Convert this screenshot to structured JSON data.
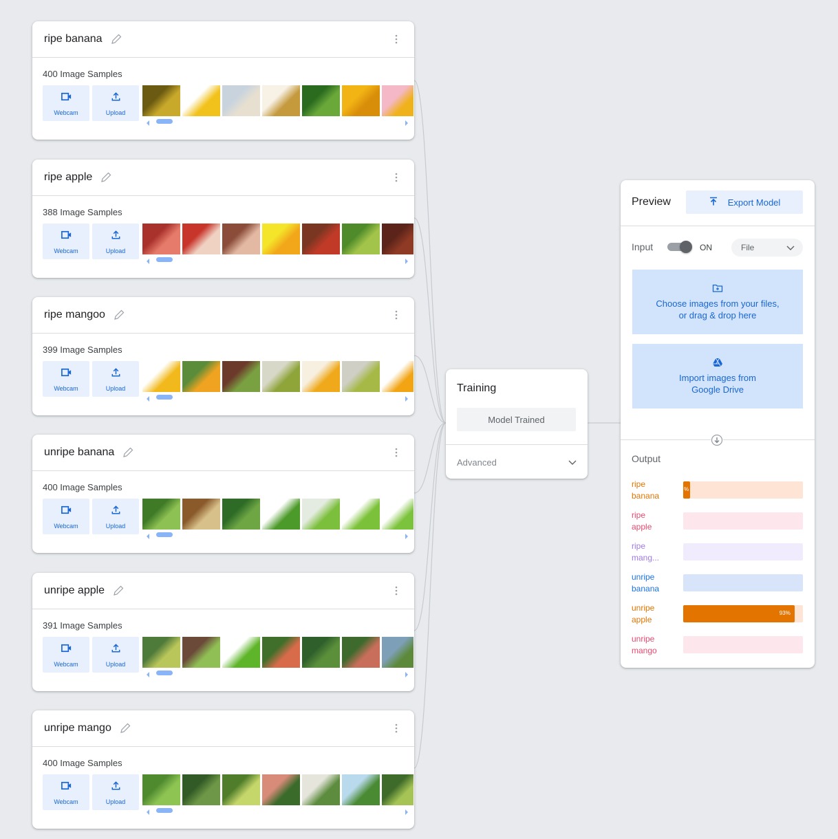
{
  "classes": [
    {
      "name": "ripe banana",
      "count_text": "400 Image Samples",
      "thumb_colors": [
        [
          "#6b5a12",
          "#c9a92a"
        ],
        [
          "#ffffff",
          "#f2c21c"
        ],
        [
          "#c9d3de",
          "#e7dfd0"
        ],
        [
          "#f7f1e6",
          "#c59a3c"
        ],
        [
          "#2a6b1f",
          "#6ba83a"
        ],
        [
          "#f2b414",
          "#d98e0a"
        ],
        [
          "#f4b8c6",
          "#f0b21a"
        ]
      ]
    },
    {
      "name": "ripe apple",
      "count_text": "388 Image Samples",
      "thumb_colors": [
        [
          "#a9322c",
          "#e77b6b"
        ],
        [
          "#c8352b",
          "#f0d2c3"
        ],
        [
          "#8b4d3a",
          "#e3b9a3"
        ],
        [
          "#f4e52a",
          "#f2a71a"
        ],
        [
          "#7b3622",
          "#c13a28"
        ],
        [
          "#4f8b2a",
          "#a3c44a"
        ],
        [
          "#5b2319",
          "#8e3a24"
        ]
      ]
    },
    {
      "name": "ripe mangoo",
      "count_text": "399 Image Samples",
      "thumb_colors": [
        [
          "#ffffff",
          "#f2b91c"
        ],
        [
          "#5b8c3a",
          "#f0a320"
        ],
        [
          "#6b3a2a",
          "#7aa141"
        ],
        [
          "#d8d8c8",
          "#8fa53a"
        ],
        [
          "#f7efe0",
          "#f0a91a"
        ],
        [
          "#cfcfc5",
          "#a6b947"
        ],
        [
          "#ffffff",
          "#f2a413"
        ]
      ]
    },
    {
      "name": "unripe banana",
      "count_text": "400 Image Samples",
      "thumb_colors": [
        [
          "#3f7a26",
          "#8ec154"
        ],
        [
          "#8a5a2b",
          "#d8c08a"
        ],
        [
          "#2e6b26",
          "#6ea644"
        ],
        [
          "#ffffff",
          "#4c9a2a"
        ],
        [
          "#e4ece1",
          "#7cbf3c"
        ],
        [
          "#ffffff",
          "#7bc23a"
        ],
        [
          "#ffffff",
          "#7cc33d"
        ]
      ]
    },
    {
      "name": "unripe apple",
      "count_text": "391 Image Samples",
      "thumb_colors": [
        [
          "#4e7a3a",
          "#b9c65a"
        ],
        [
          "#6b4a3a",
          "#8fbf55"
        ],
        [
          "#ffffff",
          "#5fb52a"
        ],
        [
          "#3f6f2a",
          "#d86b4a"
        ],
        [
          "#2f5f2a",
          "#5b8f3a"
        ],
        [
          "#3f6a2e",
          "#c86e5a"
        ],
        [
          "#7e9fb8",
          "#5d8a3a"
        ]
      ]
    },
    {
      "name": "unripe mango",
      "count_text": "400 Image Samples",
      "thumb_colors": [
        [
          "#4f8a2f",
          "#8dc452"
        ],
        [
          "#325a26",
          "#6e9847"
        ],
        [
          "#4f7d2a",
          "#c5d66a"
        ],
        [
          "#d98b7a",
          "#3a6b2a"
        ],
        [
          "#e5e5dc",
          "#5d8c3e"
        ],
        [
          "#b9d9ec",
          "#4a8a32"
        ],
        [
          "#3f6b2a",
          "#a5c455"
        ]
      ]
    }
  ],
  "buttons": {
    "webcam": "Webcam",
    "upload": "Upload"
  },
  "training": {
    "title": "Training",
    "status_button": "Model Trained",
    "advanced_label": "Advanced"
  },
  "preview": {
    "title": "Preview",
    "export_label": "Export Model",
    "input_label": "Input",
    "toggle_state": "ON",
    "input_source": "File",
    "file_drop_line1": "Choose images from your files,",
    "file_drop_line2": "or drag & drop here",
    "drive_line1": "Import images from",
    "drive_line2": "Google Drive",
    "output_label": "Output",
    "outputs": [
      {
        "line1": "ripe",
        "line2": "banana",
        "color": "#e37400",
        "bg": "#fde4d4",
        "fill": "#e37400",
        "value": 0.06,
        "pct_text": "%"
      },
      {
        "line1": "ripe",
        "line2": "apple",
        "color": "#e8496f",
        "bg": "#fde7ec",
        "fill": "#e8496f",
        "value": 0,
        "pct_text": ""
      },
      {
        "line1": "ripe",
        "line2": "mang...",
        "color": "#9e7ae6",
        "bg": "#f1ecfd",
        "fill": "#9e7ae6",
        "value": 0,
        "pct_text": ""
      },
      {
        "line1": "unripe",
        "line2": "banana",
        "color": "#1a73e8",
        "bg": "#d7e4fa",
        "fill": "#1a73e8",
        "value": 0,
        "pct_text": ""
      },
      {
        "line1": "unripe",
        "line2": "apple",
        "color": "#e37400",
        "bg": "#fde4d4",
        "fill": "#e37400",
        "value": 0.93,
        "pct_text": "93%"
      },
      {
        "line1": "unripe",
        "line2": "mango",
        "color": "#e8496f",
        "bg": "#fde7ec",
        "fill": "#e8496f",
        "value": 0,
        "pct_text": ""
      }
    ]
  }
}
